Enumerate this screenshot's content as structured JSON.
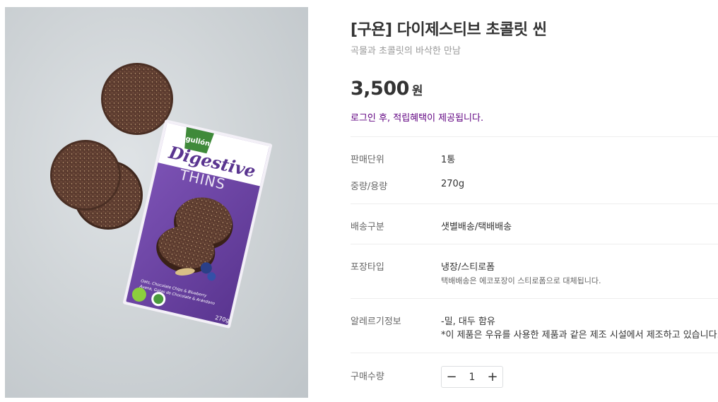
{
  "product": {
    "title": "[구욘] 다이제스티브 초콜릿 씬",
    "subtitle": "곡물과 초콜릿의 바삭한 만남",
    "price": "3,500",
    "price_unit": "원",
    "login_notice": "로그인 후, 적립혜택이 제공됩니다."
  },
  "image": {
    "brand": "gullón",
    "line1": "Digestive",
    "line2": "THINS",
    "flavor1": "Oats, Chocolate Chips & Blueberry",
    "flavor2": "Avena, Gotas de Chocolate & Arándano",
    "weight": "270g"
  },
  "specs": [
    {
      "label": "판매단위",
      "value": "1통"
    },
    {
      "label": "중량/용량",
      "value": "270g"
    },
    {
      "label": "배송구분",
      "value": "샛별배송/택배배송"
    },
    {
      "label": "포장타입",
      "value": "냉장/스티로폼",
      "note": "택배배송은 에코포장이 스티로폼으로 대체됩니다."
    },
    {
      "label": "알레르기정보",
      "value": "-밀, 대두 함유",
      "note": "*이 제품은 우유를 사용한 제품과 같은 제조 시설에서 제조하고 있습니다."
    }
  ],
  "quantity": {
    "label": "구매수량",
    "value": "1",
    "minus_symbol": "−",
    "plus_symbol": "+"
  },
  "colors": {
    "accent_purple": "#5f0080",
    "box_purple": "#6a3fa0",
    "cookie_brown": "#5a3a2e"
  }
}
